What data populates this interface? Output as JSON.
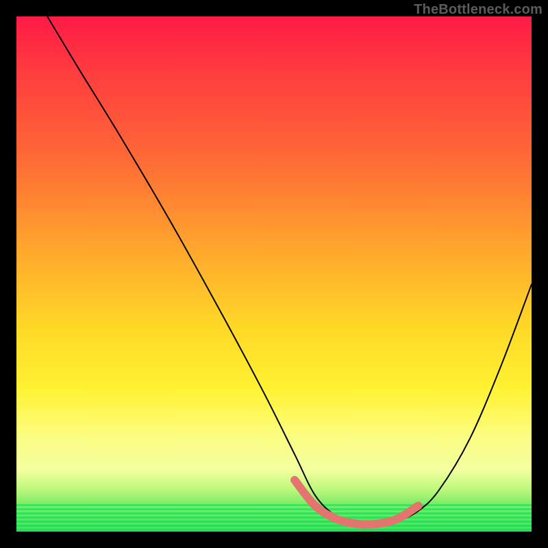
{
  "watermark": "TheBottleneck.com",
  "colors": {
    "trough_stroke": "#e4746f",
    "curve_stroke": "#000000"
  },
  "chart_data": {
    "type": "line",
    "title": "",
    "xlabel": "",
    "ylabel": "",
    "xlim": [
      0,
      100
    ],
    "ylim": [
      0,
      100
    ],
    "grid": false,
    "legend": "none",
    "series": [
      {
        "name": "bottleneck-curve",
        "x": [
          6,
          12,
          20,
          30,
          40,
          48,
          54,
          58,
          62,
          66,
          70,
          74,
          78,
          82,
          88,
          94,
          100
        ],
        "values": [
          100,
          90,
          77,
          60,
          42,
          27,
          15,
          7,
          3,
          1,
          1,
          2,
          4,
          8,
          18,
          32,
          48
        ]
      }
    ],
    "annotations": [
      {
        "name": "optimal-trough",
        "x": [
          54,
          58,
          62,
          66,
          70,
          74,
          78
        ],
        "values": [
          10,
          5,
          2.5,
          1.5,
          1.5,
          2.5,
          5
        ]
      }
    ],
    "background_gradient": [
      {
        "stop": 0,
        "color": "#ff1a46"
      },
      {
        "stop": 28,
        "color": "#ff6b36"
      },
      {
        "stop": 60,
        "color": "#ffd726"
      },
      {
        "stop": 82,
        "color": "#fcfe85"
      },
      {
        "stop": 96,
        "color": "#5de65a"
      },
      {
        "stop": 100,
        "color": "#1fd64a"
      }
    ]
  }
}
